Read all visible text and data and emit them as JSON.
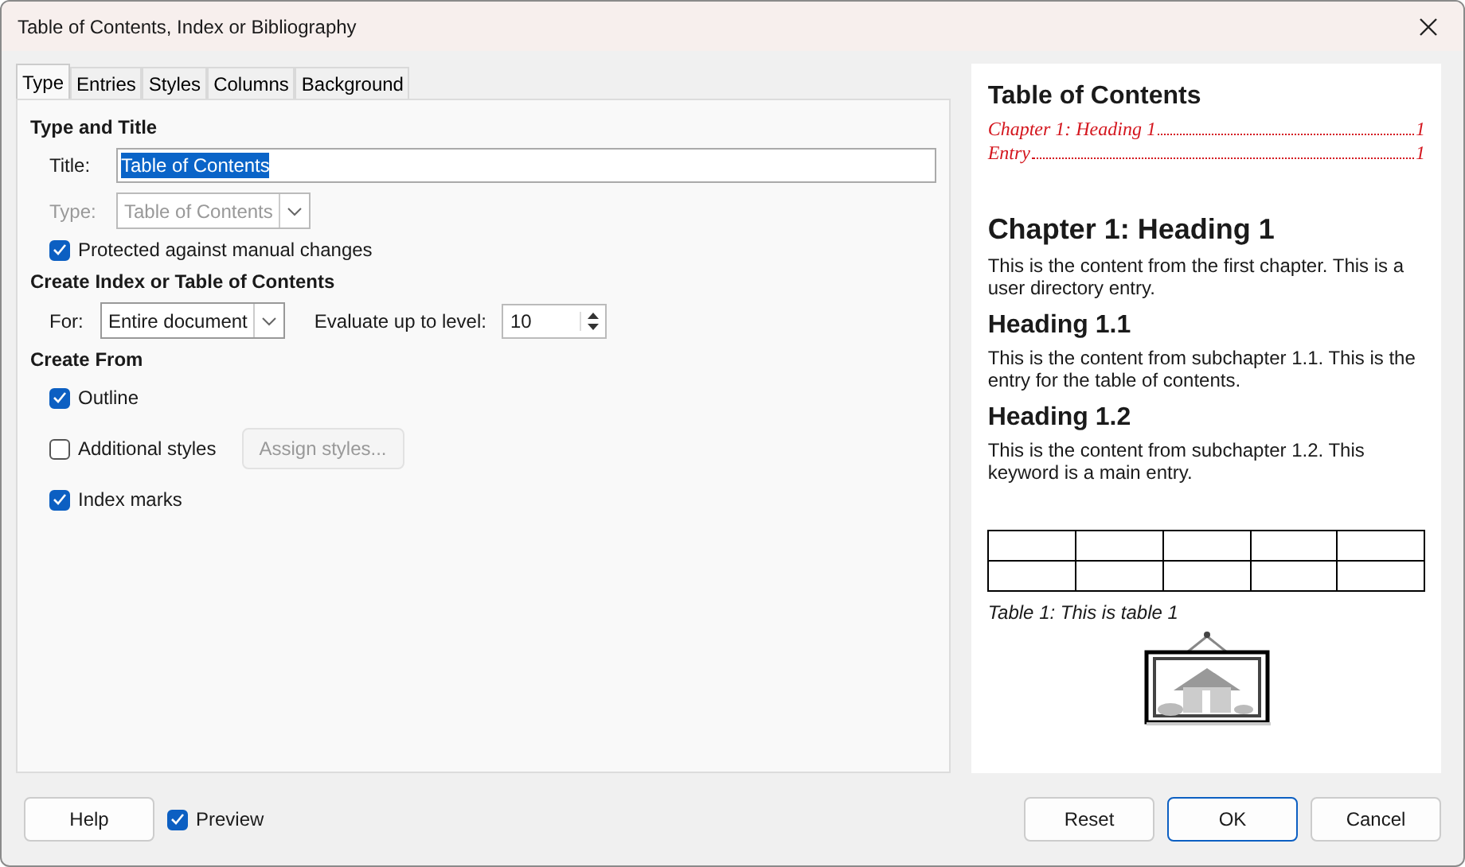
{
  "window": {
    "title": "Table of Contents, Index or Bibliography"
  },
  "tabs": [
    {
      "label": "Type",
      "selected": true
    },
    {
      "label": "Entries",
      "selected": false
    },
    {
      "label": "Styles",
      "selected": false
    },
    {
      "label": "Columns",
      "selected": false
    },
    {
      "label": "Background",
      "selected": false
    }
  ],
  "type_and_title": {
    "heading": "Type and Title",
    "title_field": {
      "label": "Title:",
      "value": "Table of Contents"
    },
    "type_field": {
      "label": "Type:",
      "value": "Table of Contents",
      "disabled": true
    },
    "protected": {
      "label": "Protected against manual changes",
      "checked": true
    }
  },
  "create_index": {
    "heading": "Create Index or Table of Contents",
    "for_field": {
      "label": "For:",
      "value": "Entire document"
    },
    "level_field": {
      "label": "Evaluate up to level:",
      "value": "10"
    }
  },
  "create_from": {
    "heading": "Create From",
    "options": [
      {
        "label": "Outline",
        "checked": true
      },
      {
        "label": "Additional styles",
        "checked": false,
        "button": {
          "label": "Assign styles...",
          "disabled": true
        }
      },
      {
        "label": "Index marks",
        "checked": true
      }
    ]
  },
  "preview": {
    "toc_title": "Table of Contents",
    "toc_entries": [
      {
        "text": "Chapter 1:  Heading 1",
        "page": "1"
      },
      {
        "text": "Entry",
        "page": "1"
      }
    ],
    "blocks": [
      {
        "kind": "heading1",
        "text": "Chapter 1:  Heading 1"
      },
      {
        "kind": "paragraph",
        "text": "This is the content from the first chapter. This is a user directory entry."
      },
      {
        "kind": "heading2",
        "text": "Heading 1.1"
      },
      {
        "kind": "paragraph",
        "text": "This is the content from subchapter 1.1. This is the entry for the table of contents."
      },
      {
        "kind": "heading2",
        "text": "Heading 1.2"
      },
      {
        "kind": "paragraph",
        "text": "This is the content from subchapter 1.2. This keyword is a main entry."
      },
      {
        "kind": "table"
      },
      {
        "kind": "caption",
        "text": "Table 1: This is table 1"
      },
      {
        "kind": "image"
      }
    ]
  },
  "footer": {
    "help": "Help",
    "preview_toggle": {
      "label": "Preview",
      "checked": true
    },
    "buttons": [
      {
        "label": "Reset",
        "default": false
      },
      {
        "label": "OK",
        "default": true
      },
      {
        "label": "Cancel",
        "default": false
      }
    ]
  }
}
